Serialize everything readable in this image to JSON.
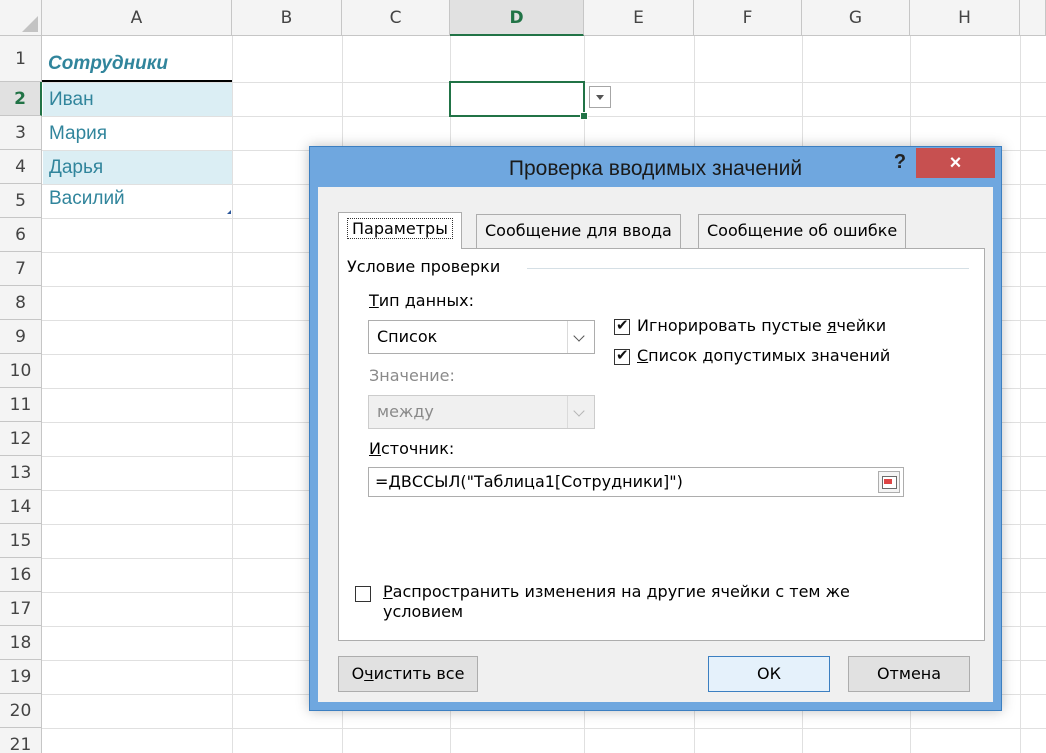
{
  "spreadsheet": {
    "columns": [
      "A",
      "B",
      "C",
      "D",
      "E",
      "F",
      "G",
      "H"
    ],
    "rows": [
      "1",
      "2",
      "3",
      "4",
      "5",
      "6",
      "7",
      "8",
      "9",
      "10",
      "11",
      "12",
      "13",
      "14",
      "15",
      "16",
      "17",
      "18",
      "19",
      "20",
      "21"
    ],
    "selected_column": "D",
    "selected_row": "2",
    "table_header": "Сотрудники",
    "names": [
      "Иван",
      "Мария",
      "Дарья",
      "Василий"
    ],
    "colors": {
      "accent": "#217346",
      "table_text": "#31859c",
      "band": "#dbeef4"
    }
  },
  "dialog": {
    "title": "Проверка вводимых значений",
    "help_label": "?",
    "close_label": "×",
    "tabs": [
      "Параметры",
      "Сообщение для ввода",
      "Сообщение об ошибке"
    ],
    "active_tab": "Параметры",
    "group_title": "Условие проверки",
    "data_type_label_first": "Т",
    "data_type_label_rest": "ип данных:",
    "data_type_value": "Список",
    "value_label": "Значение:",
    "value_value": "между",
    "ignore_blank_pre": "Игнорировать пустые ",
    "ignore_blank_u": "я",
    "ignore_blank_post": "чейки",
    "ignore_blank_checked": true,
    "in_cell_dropdown_u": "С",
    "in_cell_dropdown_post": "писок допустимых значений",
    "in_cell_dropdown_checked": true,
    "source_label_u": "И",
    "source_label_post": "сточник:",
    "source_value": "=ДВССЫЛ(\"Таблица1[Сотрудники]\")",
    "apply_line1_u": "Р",
    "apply_line1_post": "аспространить изменения на другие ячейки с тем же",
    "apply_line2": "условием",
    "apply_checked": false,
    "clear_all_pre": "О",
    "clear_all_u": "ч",
    "clear_all_post": "истить все",
    "ok_label": "ОК",
    "cancel_label": "Отмена",
    "colors": {
      "frame": "#6fa7df",
      "close": "#c75050"
    }
  }
}
